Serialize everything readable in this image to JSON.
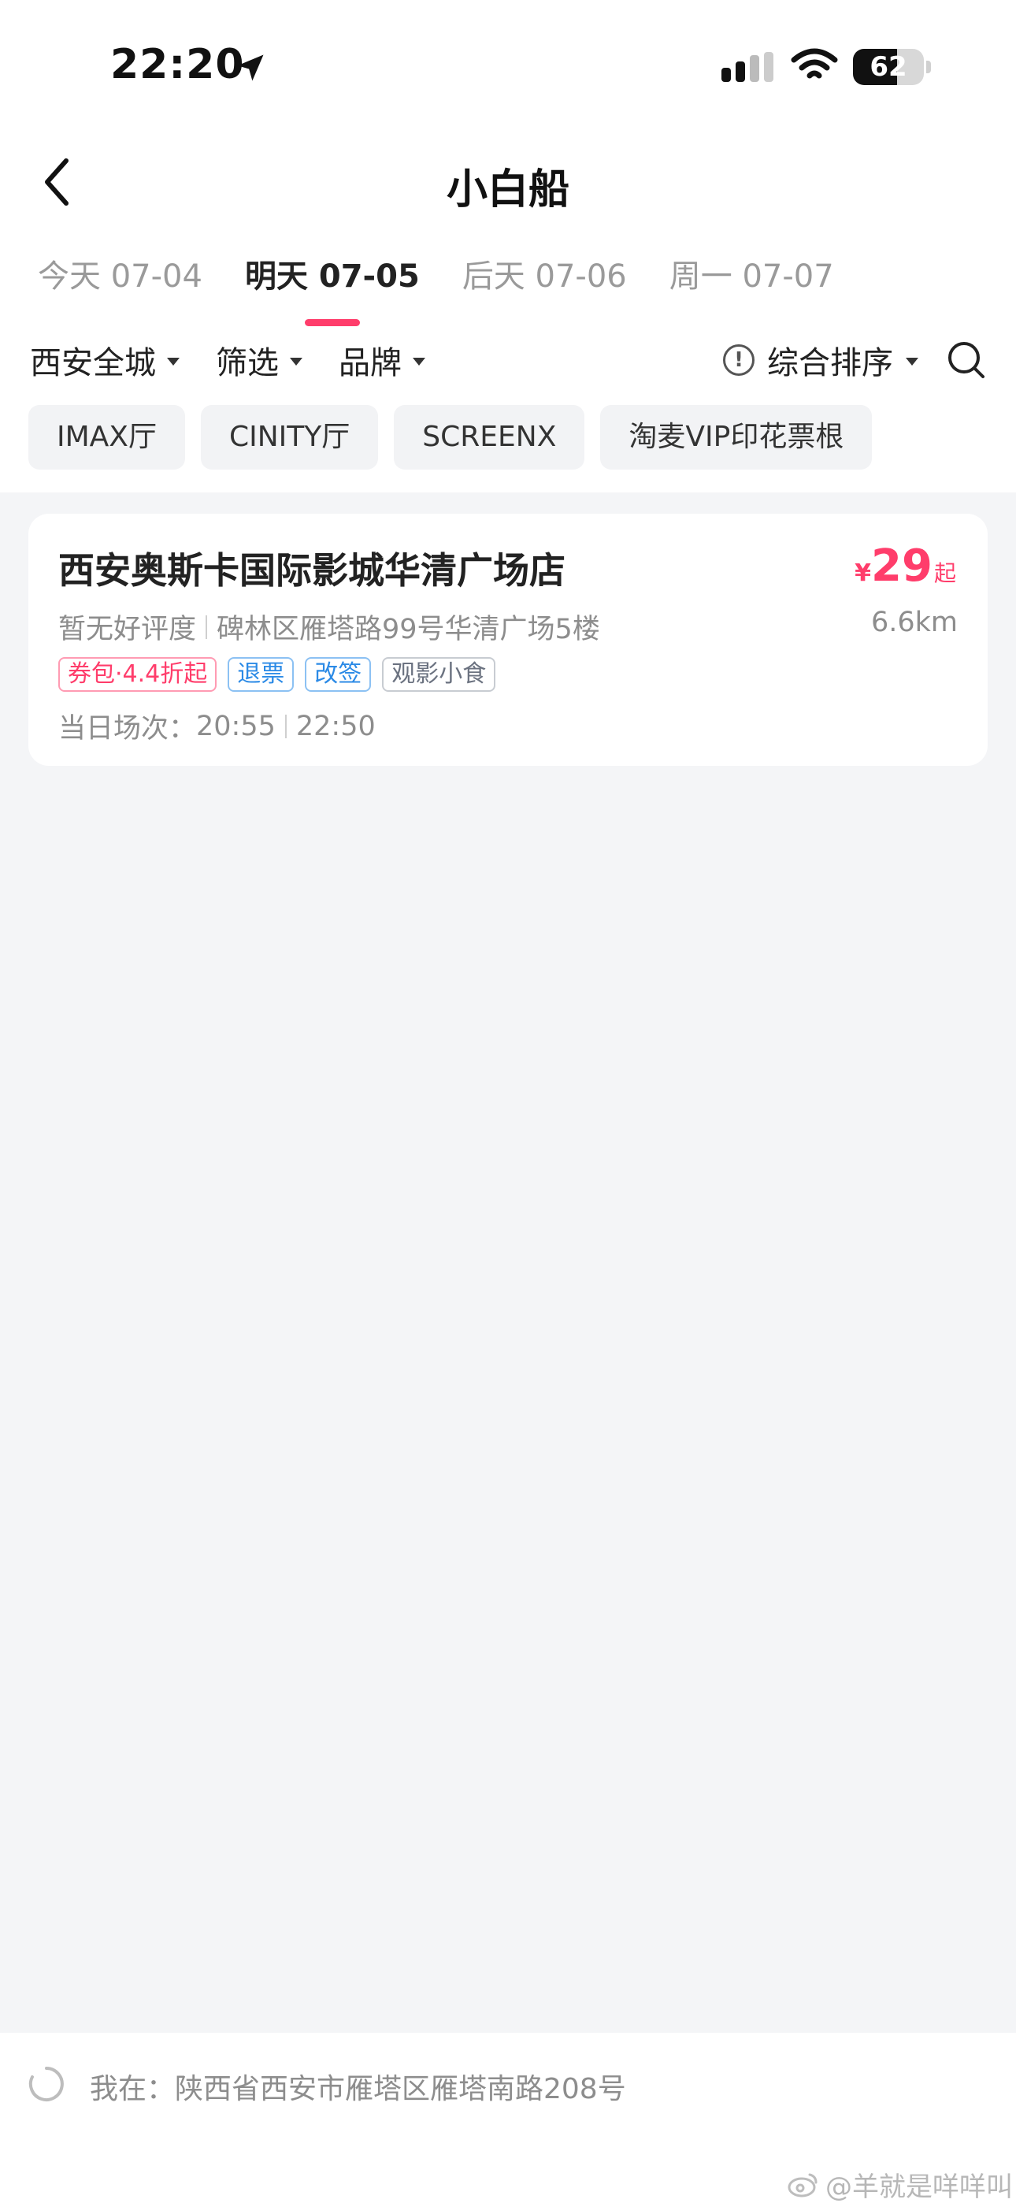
{
  "status_bar": {
    "time": "22:20",
    "battery": "62"
  },
  "nav": {
    "title": "小白船",
    "back_icon": "chevron-left-icon"
  },
  "date_tabs": [
    {
      "label": "今天 07-04",
      "active": false
    },
    {
      "label": "明天 07-05",
      "active": true
    },
    {
      "label": "后天 07-06",
      "active": false
    },
    {
      "label": "周一 07-07",
      "active": false
    }
  ],
  "filters": {
    "city": "西安全城",
    "screen": "筛选",
    "brand": "品牌",
    "sort": "综合排序"
  },
  "chips": [
    "IMAX厅",
    "CINITY厅",
    "SCREENX",
    "淘麦VIP印花票根"
  ],
  "cinema": {
    "name": "西安奥斯卡国际影城华清广场店",
    "price_currency": "¥",
    "price_value": "29",
    "price_suffix": "起",
    "rating": "暂无好评度",
    "address": "碑林区雁塔路99号华清广场5楼",
    "distance": "6.6km",
    "tags": [
      "券包·4.4折起",
      "退票",
      "改签",
      "观影小食"
    ],
    "showtimes_label": "当日场次：",
    "showtimes": [
      "20:55",
      "22:50"
    ]
  },
  "location": {
    "text": "我在：陕西省西安市雁塔区雁塔南路208号"
  },
  "watermark": "@羊就是咩咩叫",
  "colors": {
    "accent": "#ff3d6b",
    "blue_tag": "#2b8ae6",
    "background": "#f4f5f7"
  }
}
